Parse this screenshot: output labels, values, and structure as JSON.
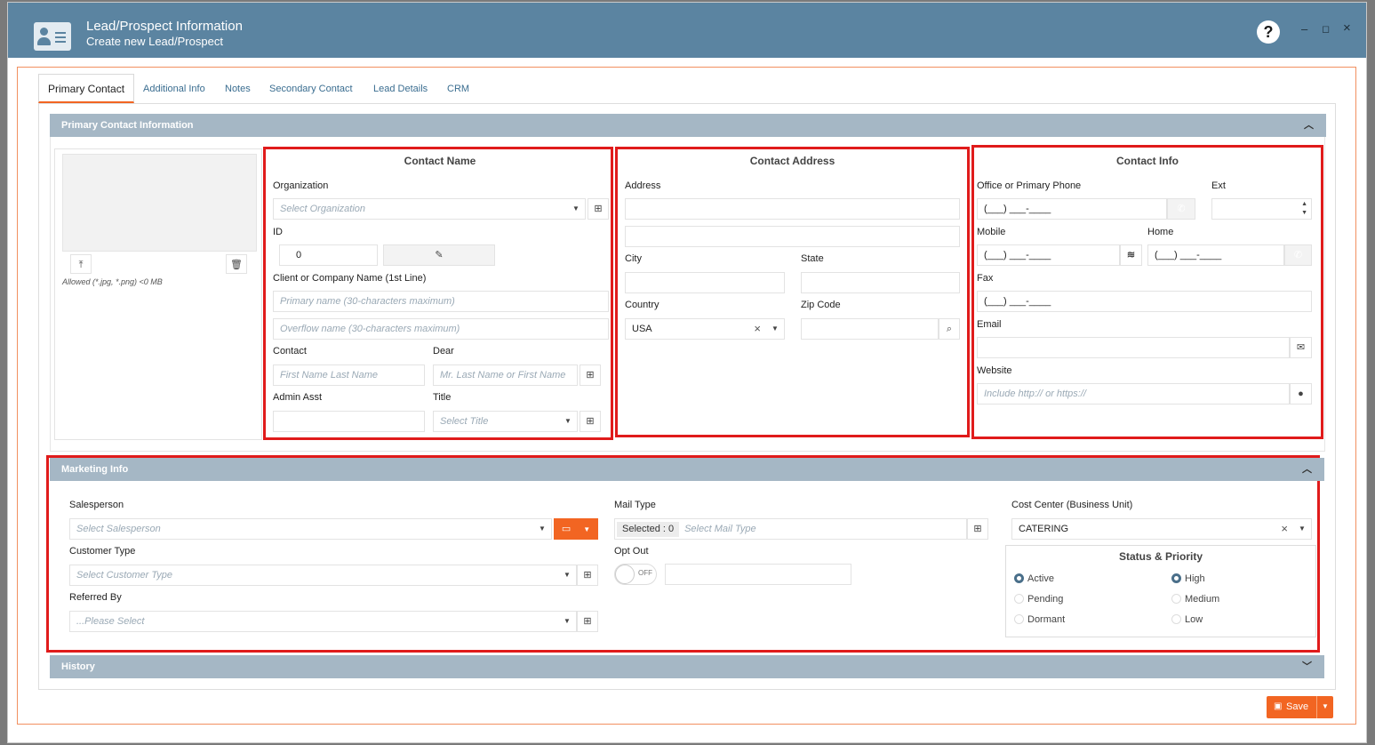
{
  "window": {
    "title": "Lead/Prospect Information",
    "subtitle": "Create new Lead/Prospect",
    "help": "?",
    "minimize": "–",
    "maximize": "◻",
    "close": "×"
  },
  "tabs": [
    "Primary Contact",
    "Additional Info",
    "Notes",
    "Secondary Contact",
    "Lead Details",
    "CRM"
  ],
  "primary_panel": {
    "title": "Primary Contact Information",
    "image_hint": "Allowed (*.jpg, *.png) <0 MB",
    "contact_name": {
      "header": "Contact Name",
      "organization_label": "Organization",
      "organization_placeholder": "Select Organization",
      "id_label": "ID",
      "id_value": "0",
      "company_label": "Client or Company Name (1st Line)",
      "primary_placeholder": "Primary name (30-characters maximum)",
      "overflow_placeholder": "Overflow name (30-characters maximum)",
      "contact_label": "Contact",
      "contact_placeholder": "First Name Last Name",
      "dear_label": "Dear",
      "dear_placeholder": "Mr. Last Name or First Name",
      "admin_label": "Admin Asst",
      "title_label": "Title",
      "title_placeholder": "Select Title"
    },
    "contact_address": {
      "header": "Contact Address",
      "address_label": "Address",
      "city_label": "City",
      "state_label": "State",
      "country_label": "Country",
      "country_value": "USA",
      "zip_label": "Zip Code"
    },
    "contact_info": {
      "header": "Contact Info",
      "phone_label": "Office or Primary Phone",
      "ext_label": "Ext",
      "mobile_label": "Mobile",
      "home_label": "Home",
      "fax_label": "Fax",
      "email_label": "Email",
      "website_label": "Website",
      "website_placeholder": "Include http:// or https://",
      "phone_mask": "(___) ___-____"
    }
  },
  "marketing_panel": {
    "title": "Marketing Info",
    "salesperson_label": "Salesperson",
    "salesperson_placeholder": "Select Salesperson",
    "customer_type_label": "Customer Type",
    "customer_type_placeholder": "Select Customer Type",
    "referred_label": "Referred By",
    "referred_placeholder": "...Please Select",
    "mail_type_label": "Mail Type",
    "mail_selected": "Selected : 0",
    "mail_placeholder": "Select Mail Type",
    "opt_out_label": "Opt Out",
    "opt_out_state": "OFF",
    "cost_center_label": "Cost Center (Business Unit)",
    "cost_center_value": "CATERING",
    "status_header": "Status & Priority",
    "status": [
      "Active",
      "Pending",
      "Dormant"
    ],
    "status_selected": "Active",
    "priority": [
      "High",
      "Medium",
      "Low"
    ],
    "priority_selected": "High"
  },
  "history_panel": {
    "title": "History"
  },
  "footer": {
    "save_label": "Save"
  },
  "colors": {
    "titlebar": "#5b84a1",
    "accent": "#f26522",
    "highlight": "#e01b1b",
    "panel": "#a5b7c5"
  }
}
